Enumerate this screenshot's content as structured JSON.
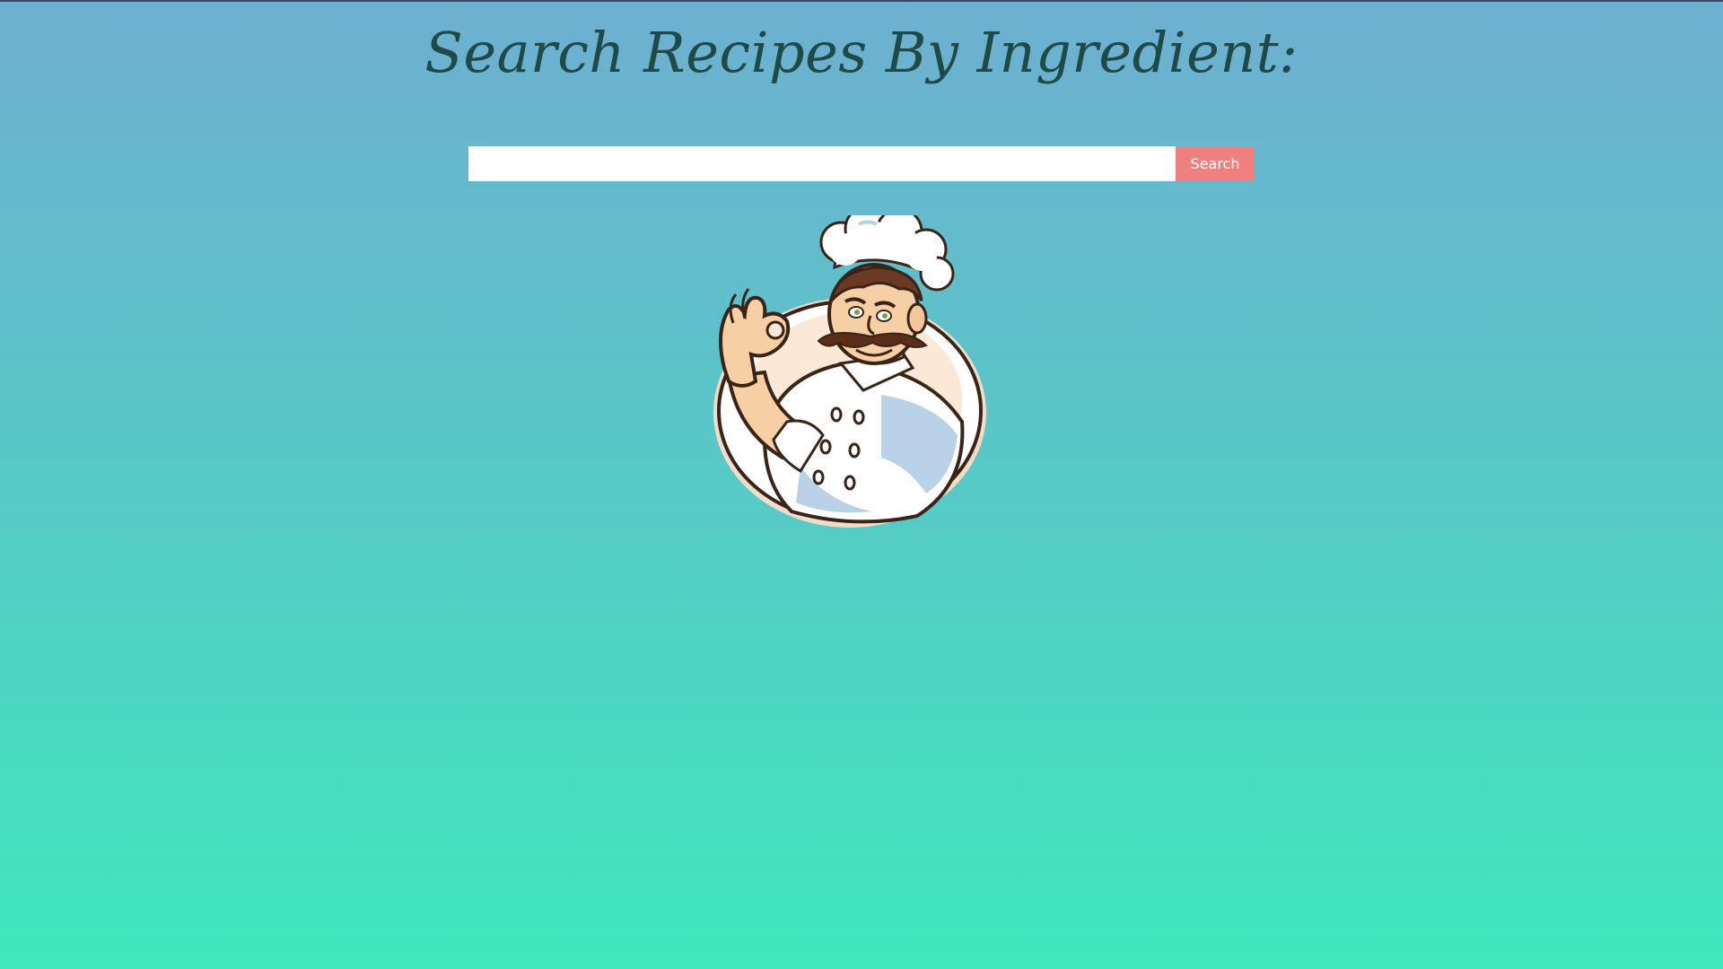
{
  "header": {
    "title": "Search Recipes By Ingredient:"
  },
  "search": {
    "placeholder": "",
    "value": "",
    "button_label": "Search"
  },
  "logo": {
    "icon": "chef-mascot-icon"
  },
  "colors": {
    "gradient_top": "#6eafd1",
    "gradient_bottom": "#3ee8bc",
    "title": "#1f4a45",
    "button": "#f08080"
  }
}
